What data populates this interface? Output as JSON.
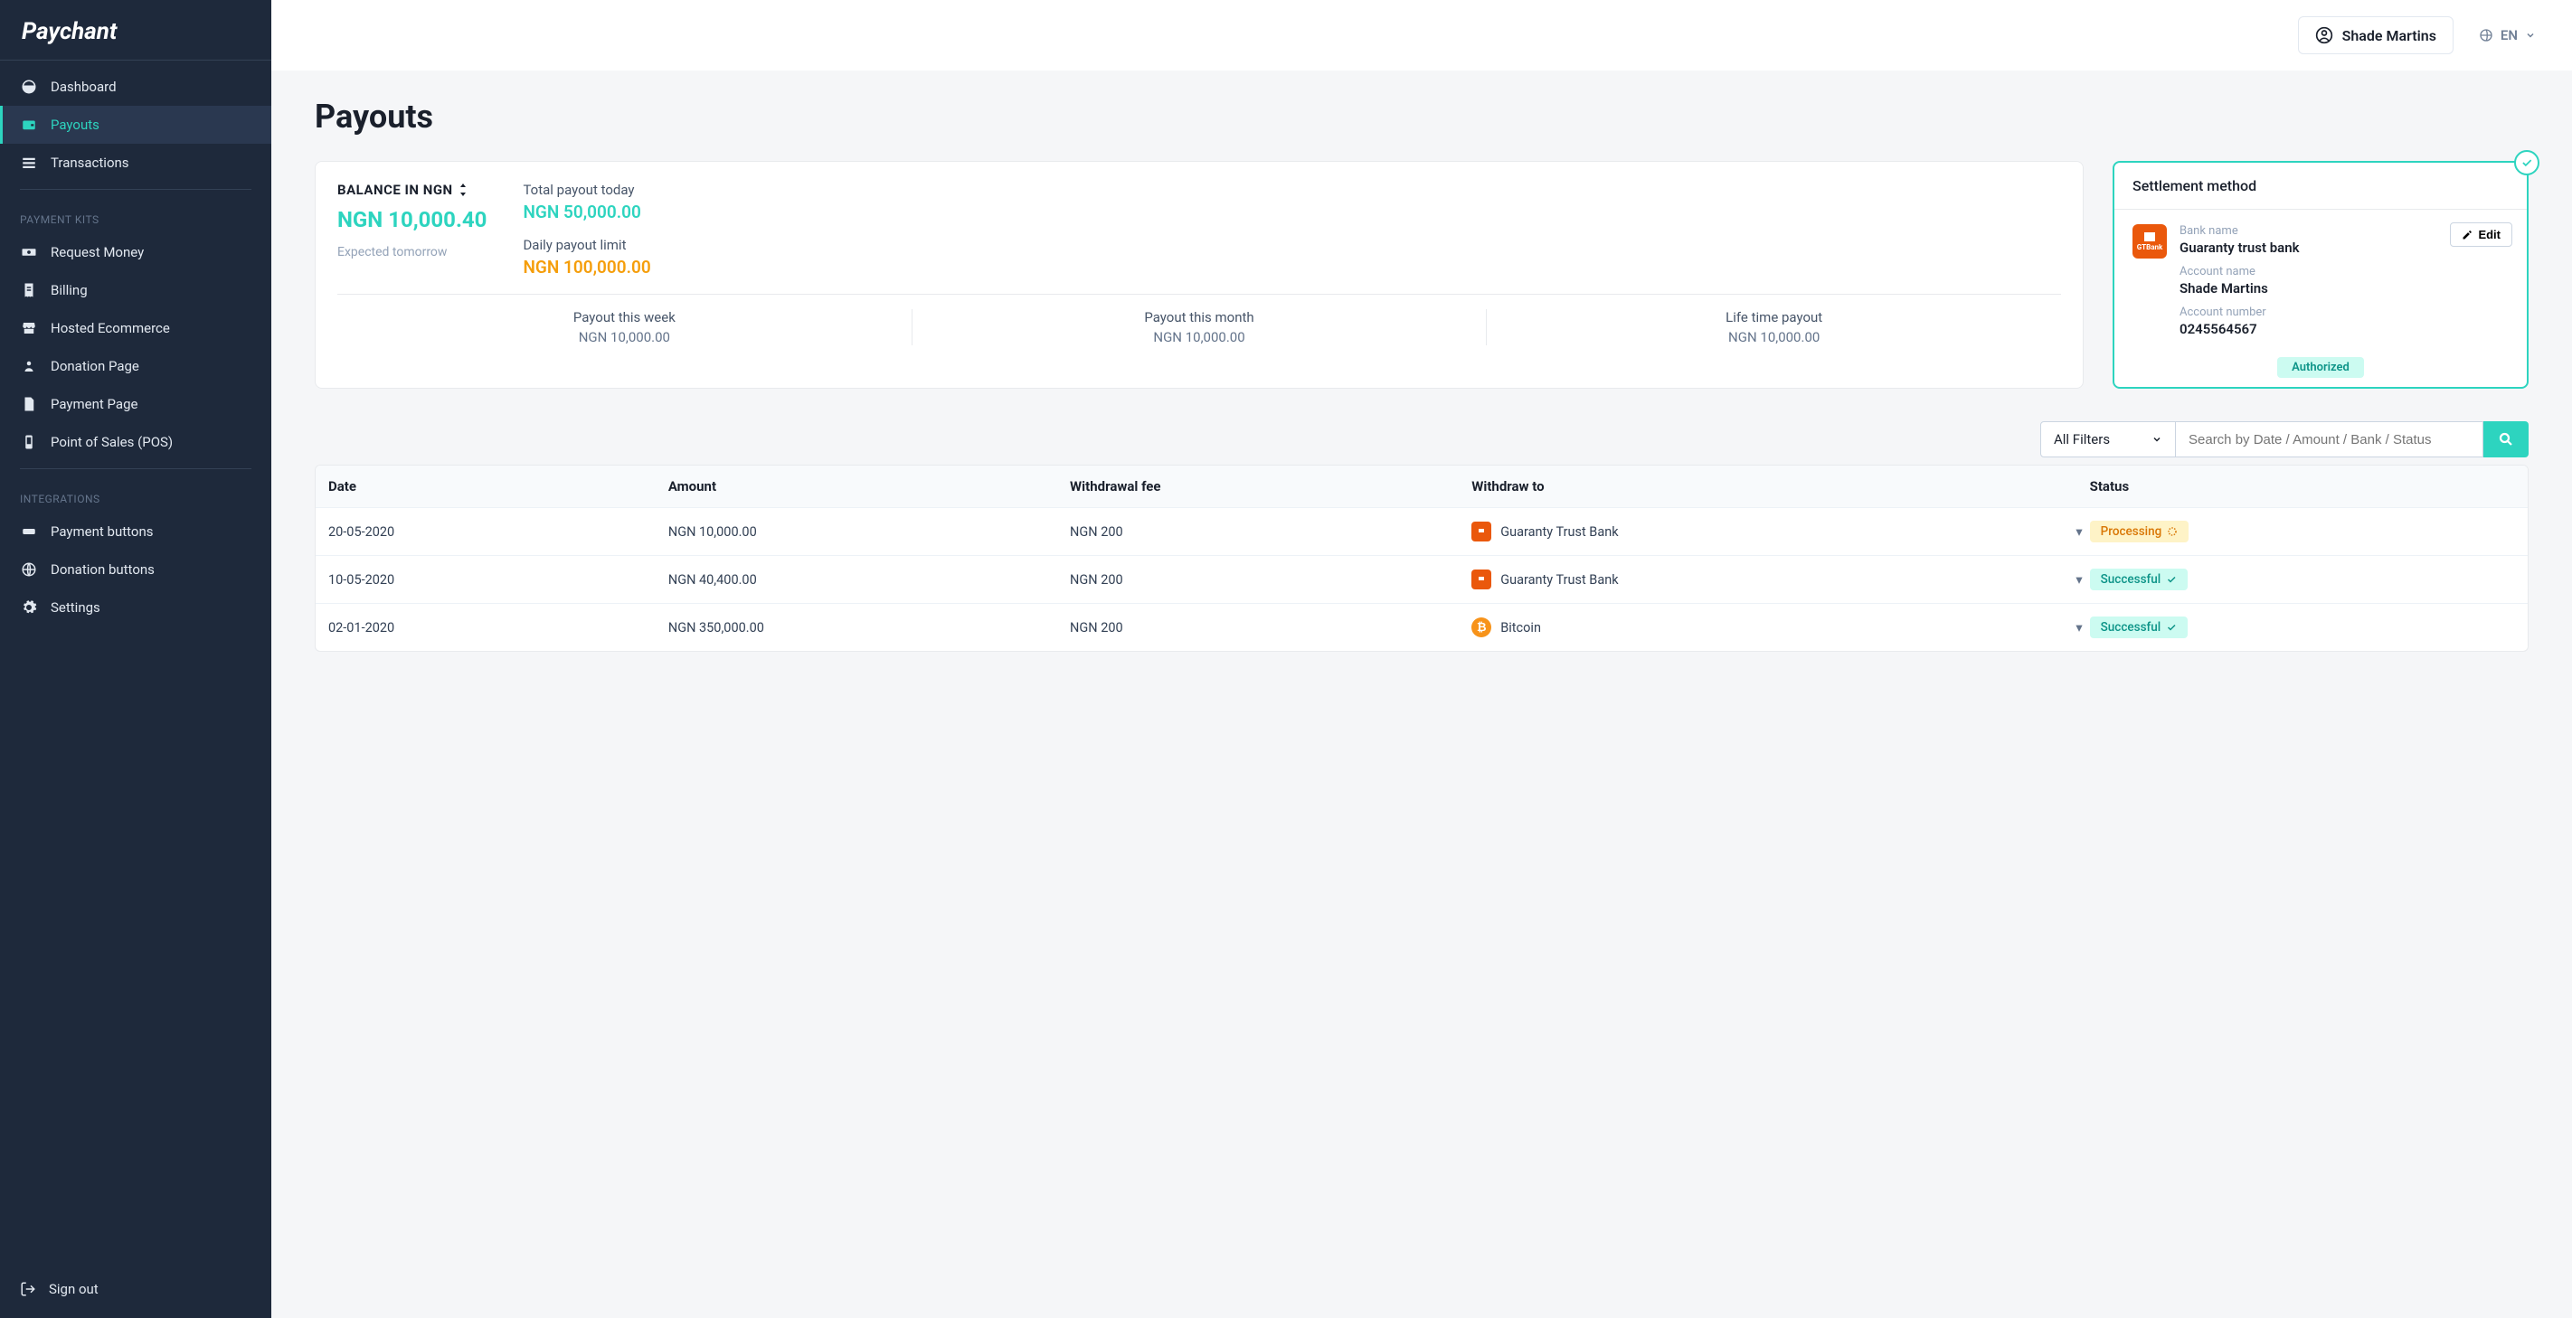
{
  "brand": "Paychant",
  "sidebar": {
    "items": [
      {
        "label": "Dashboard"
      },
      {
        "label": "Payouts"
      },
      {
        "label": "Transactions"
      }
    ],
    "section1": "PAYMENT KITS",
    "kits": [
      {
        "label": "Request Money"
      },
      {
        "label": "Billing"
      },
      {
        "label": "Hosted Ecommerce"
      },
      {
        "label": "Donation Page"
      },
      {
        "label": "Payment Page"
      },
      {
        "label": "Point of Sales (POS)"
      }
    ],
    "section2": "INTEGRATIONS",
    "integrations": [
      {
        "label": "Payment buttons"
      },
      {
        "label": "Donation buttons"
      },
      {
        "label": "Settings"
      }
    ],
    "signout": "Sign out"
  },
  "topbar": {
    "user": "Shade Martins",
    "lang": "EN"
  },
  "page": {
    "title": "Payouts"
  },
  "balance": {
    "label": "BALANCE IN NGN",
    "amount": "NGN 10,000.40",
    "expected": "Expected tomorrow",
    "today_label": "Total payout today",
    "today_value": "NGN 50,000.00",
    "limit_label": "Daily payout limit",
    "limit_value": "NGN 100,000.00",
    "week_label": "Payout this week",
    "week_value": "NGN 10,000.00",
    "month_label": "Payout this month",
    "month_value": "NGN 10,000.00",
    "life_label": "Life time payout",
    "life_value": "NGN 10,000.00"
  },
  "settlement": {
    "title": "Settlement method",
    "edit": "Edit",
    "bank_name_label": "Bank name",
    "bank_name": "Guaranty trust bank",
    "account_name_label": "Account name",
    "account_name": "Shade Martins",
    "account_number_label": "Account number",
    "account_number": "0245564567",
    "authorized": "Authorized"
  },
  "filters": {
    "all": "All Filters",
    "search_placeholder": "Search by Date / Amount / Bank / Status"
  },
  "table": {
    "headers": {
      "date": "Date",
      "amount": "Amount",
      "fee": "Withdrawal fee",
      "to": "Withdraw to",
      "status": "Status"
    },
    "rows": [
      {
        "date": "20-05-2020",
        "amount": "NGN 10,000.00",
        "fee": "NGN 200",
        "to": "Guaranty Trust Bank",
        "to_type": "gtb",
        "status": "Processing",
        "status_type": "processing"
      },
      {
        "date": "10-05-2020",
        "amount": "NGN 40,400.00",
        "fee": "NGN 200",
        "to": "Guaranty Trust Bank",
        "to_type": "gtb",
        "status": "Successful",
        "status_type": "successful"
      },
      {
        "date": "02-01-2020",
        "amount": "NGN 350,000.00",
        "fee": "NGN 200",
        "to": "Bitcoin",
        "to_type": "btc",
        "status": "Successful",
        "status_type": "successful"
      }
    ]
  }
}
